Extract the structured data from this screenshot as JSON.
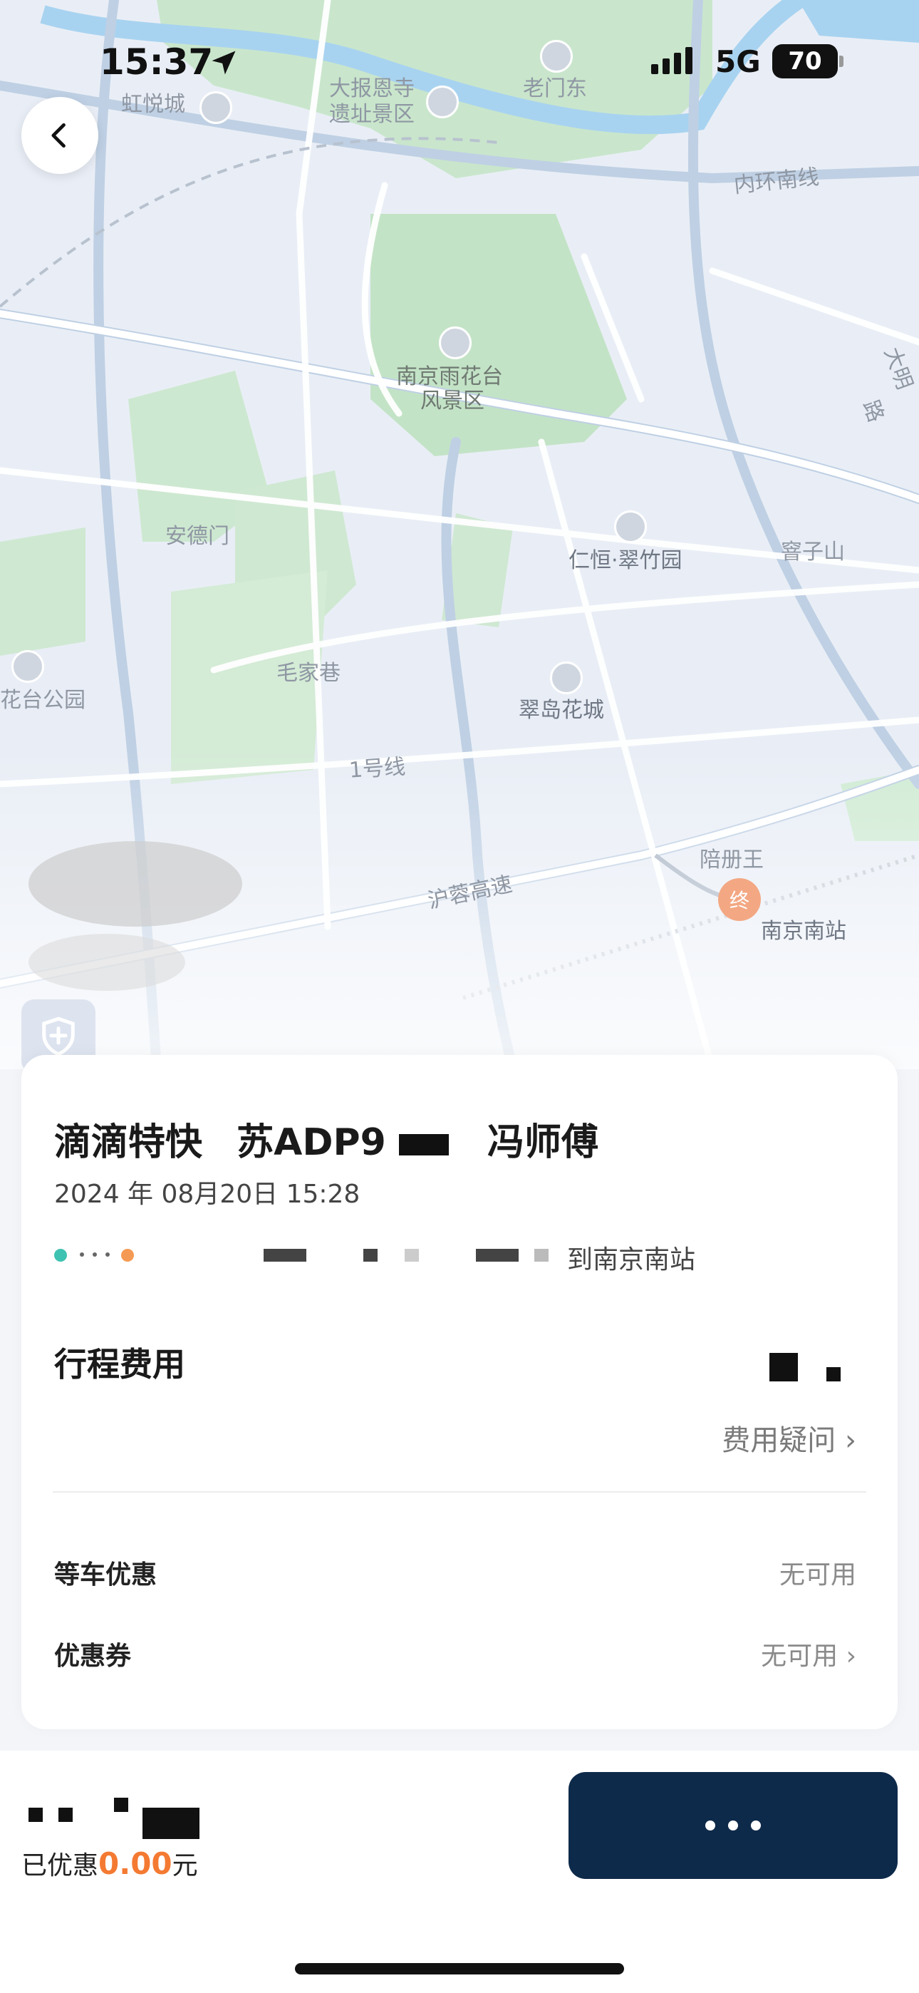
{
  "status": {
    "time": "15:37",
    "network": "5G",
    "battery": "70"
  },
  "map": {
    "labels": [
      "虹悦城",
      "大报恩寺",
      "遗址景区",
      "老门东",
      "内环南线",
      "南京雨花台",
      "风景区",
      "大明",
      "路",
      "安德门",
      "仁恒·翠竹园",
      "窨子山",
      "毛家巷",
      "花台公园",
      "翠岛花城",
      "1号线",
      "沪蓉高速",
      "南京南站",
      "终",
      "陪册王"
    ]
  },
  "trip": {
    "service": "滴滴特快",
    "plate": "苏ADP9",
    "driver": "冯师傅",
    "date": "2024 年 08月20日 15:28",
    "destination": "到南京南站"
  },
  "fee": {
    "title": "行程费用",
    "question": "费用疑问",
    "rows": [
      {
        "label": "等车优惠",
        "value": "无可用"
      },
      {
        "label": "优惠券",
        "value": "无可用"
      }
    ]
  },
  "footer": {
    "discount_prefix": "已优惠",
    "discount_value": "0.00",
    "discount_suffix": "元"
  },
  "colors": {
    "accent": "#f47a32",
    "button": "#0e2a4a",
    "start_dot": "#3ec2b1",
    "end_dot": "#f59a54"
  },
  "icons": [
    "location-arrow-icon",
    "back-chevron-icon",
    "shield-plus-icon",
    "chevron-right-icon",
    "more-dots-icon"
  ]
}
